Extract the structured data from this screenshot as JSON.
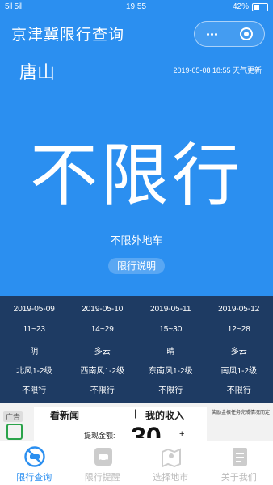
{
  "status_bar": {
    "signal": "5il 5il",
    "time": "19:55",
    "battery": "42%",
    "battery_level": 0.42
  },
  "header": {
    "title": "京津冀限行查询"
  },
  "city": "唐山",
  "update_text": "2019-05-08 18:55 天气更新",
  "today": {
    "status": "不限行",
    "detail": "不限外地车",
    "rule_button": "限行说明"
  },
  "forecast": [
    {
      "date": "2019-05-09",
      "temp": "11~23",
      "weather": "阴",
      "wind": "北风1-2级",
      "limit": "不限行"
    },
    {
      "date": "2019-05-10",
      "temp": "14~29",
      "weather": "多云",
      "wind": "西南风1-2级",
      "limit": "不限行"
    },
    {
      "date": "2019-05-11",
      "temp": "15~30",
      "weather": "晴",
      "wind": "东南风1-2级",
      "limit": "不限行"
    },
    {
      "date": "2019-05-12",
      "temp": "12~28",
      "weather": "多云",
      "wind": "南风1-2级",
      "limit": "不限行"
    }
  ],
  "ad": {
    "tag": "广告",
    "note": "奖励金根任务完成情况而定",
    "tab1": "看新闻",
    "separator": "|",
    "tab2": "我的收入",
    "amount_label": "提现金额:",
    "amount": "30",
    "plus": "+"
  },
  "tabs": [
    {
      "label": "限行查询",
      "icon": "no-car-icon",
      "active": true
    },
    {
      "label": "限行提醒",
      "icon": "car-reminder-icon",
      "active": false
    },
    {
      "label": "选择地市",
      "icon": "map-icon",
      "active": false
    },
    {
      "label": "关于我们",
      "icon": "document-icon",
      "active": false
    }
  ],
  "colors": {
    "primary": "#2b8ff0",
    "forecast_bg": "#1e3b63",
    "tab_inactive": "#bbbbbb"
  }
}
